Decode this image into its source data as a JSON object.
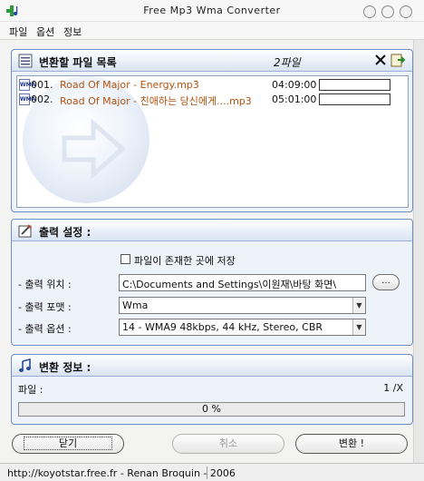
{
  "window": {
    "title": "Free Mp3 Wma Converter"
  },
  "menu": [
    "파일",
    "옵션",
    "정보"
  ],
  "file_list": {
    "title": "변환할 파일 목록",
    "count": "2파일",
    "files": [
      {
        "num": "001.",
        "name": "Road Of Major - Energy.mp3",
        "time": "04:09:00"
      },
      {
        "num": "002.",
        "name": "Road Of Major - 친애하는 당신에게....mp3",
        "time": "05:01:00"
      }
    ]
  },
  "output": {
    "title": "출력 설정 :",
    "save_same_location": "파일이 존재한 곳에 저장",
    "location_label": "- 출력 위치 :",
    "location_value": "C:\\Documents and Settings\\이원재\\바탕 화면\\",
    "browse_label": "...",
    "format_label": "- 출력 포맷 :",
    "format_value": "Wma",
    "option_label": "- 출력 옵션 :",
    "option_value": "14 - WMA9 48kbps, 44 kHz, Stereo, CBR"
  },
  "info": {
    "title": "변환 정보 :",
    "file_label": "파일 :",
    "file_count": "1 /X",
    "progress_text": "0 %",
    "progress_value": 0
  },
  "buttons": {
    "close": "닫기",
    "cancel": "취소",
    "convert": "변환 !"
  },
  "status": {
    "text": "http://koyotstar.free.fr - Renan Broquin - 2006"
  },
  "colors": {
    "panel_border": "#6f8fc8",
    "file_name": "#b4520e"
  }
}
